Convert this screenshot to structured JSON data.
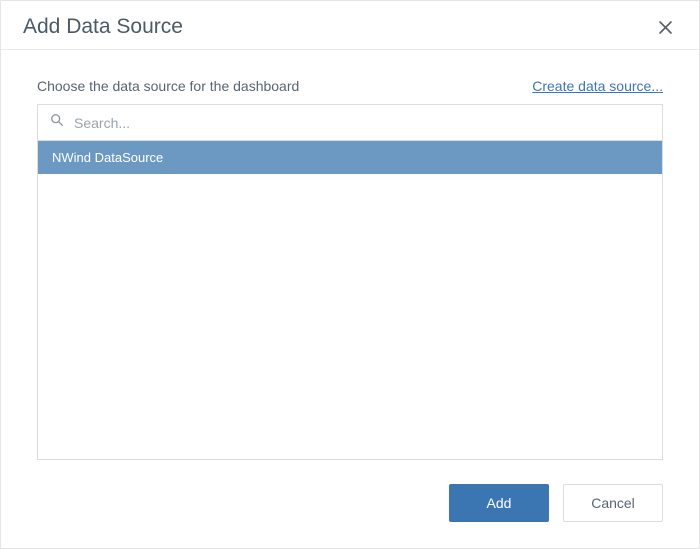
{
  "dialog": {
    "title": "Add Data Source",
    "instruction": "Choose the data source for the dashboard",
    "create_link": "Create data source...",
    "search_placeholder": "Search...",
    "items": [
      {
        "label": "NWind DataSource",
        "selected": true
      }
    ],
    "buttons": {
      "add": "Add",
      "cancel": "Cancel"
    }
  }
}
